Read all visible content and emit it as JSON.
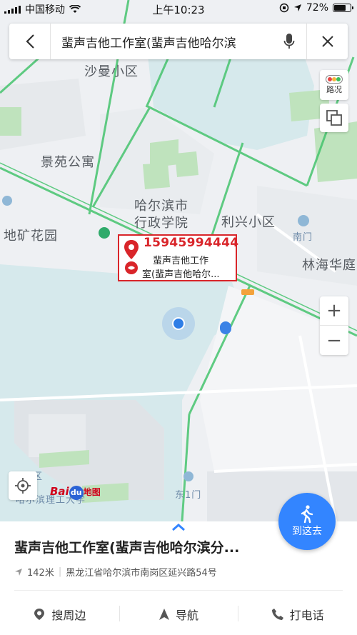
{
  "status_bar": {
    "carrier": "中国移动",
    "time": "上午10:23",
    "battery_percent": "72%",
    "battery_level": 0.72
  },
  "search": {
    "query": "蜚声吉他工作室(蜚声吉他哈尔滨"
  },
  "controls": {
    "traffic_label": "路况",
    "zoom_in": "+",
    "zoom_out": "−"
  },
  "map_labels": {
    "shaman": "沙曼小区",
    "jingyuan": "景苑公寓",
    "admin_college_1": "哈尔滨市",
    "admin_college_2": "行政学院",
    "lixing": "利兴小区",
    "dikuang": "地矿花园",
    "nanmen": "南门",
    "linhai": "林海华庭",
    "dongyimen": "东1门",
    "ligong": "哈尔滨理工大学",
    "qu": "区"
  },
  "callout": {
    "phone": "15945994444",
    "name_line1": "蜚声吉他工作",
    "name_line2": "室(蜚声吉他哈尔..."
  },
  "logo": {
    "bai": "Bai",
    "du": "du",
    "map": "地图"
  },
  "walk_button": {
    "label": "到这去"
  },
  "place": {
    "title": "蜚声吉他工作室(蜚声吉他哈尔滨分...",
    "distance": "142米",
    "address": "黑龙江省哈尔滨市南岗区延兴路54号"
  },
  "actions": [
    {
      "label": "搜周边",
      "icon": "search-nearby-icon"
    },
    {
      "label": "导航",
      "icon": "navigation-icon"
    },
    {
      "label": "打电话",
      "icon": "phone-icon"
    }
  ],
  "colors": {
    "accent": "#3385ff",
    "callout_red": "#d9252a",
    "road_green": "#46c46e",
    "water": "#d6e9ec"
  }
}
